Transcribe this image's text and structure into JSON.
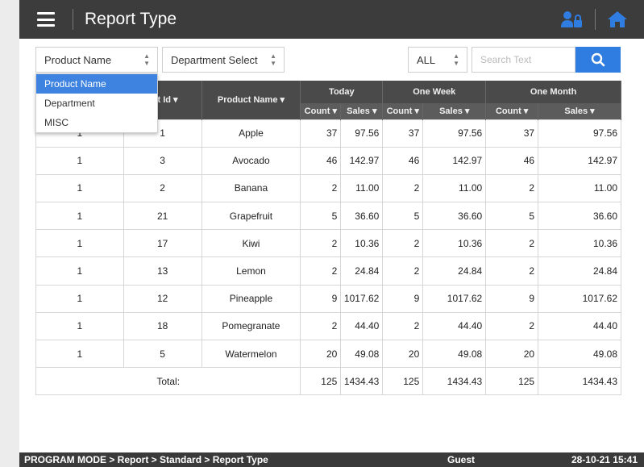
{
  "header": {
    "title": "Report Type",
    "menu_icon": "hamburger-icon",
    "user_icon": "users-lock-icon",
    "home_icon": "home-icon",
    "accent": "#2f7de1"
  },
  "filters": {
    "group_select": "Product Name",
    "department_select": "Department Select",
    "scope_select": "ALL",
    "search_placeholder": "Search Text",
    "search_value": ""
  },
  "dropdown": {
    "options": [
      "Product Name",
      "Department",
      "MISC"
    ],
    "selected": "Product Name"
  },
  "table": {
    "col1_header": "",
    "product_id_header": "uct Id ▾",
    "product_name_header": "Product Name ▾",
    "period_headers": [
      "Today",
      "One Week",
      "One Month"
    ],
    "sub_headers": [
      "Count ▾",
      "Sales ▾",
      "Count ▾",
      "Sales ▾",
      "Count ▾",
      "Sales ▾"
    ],
    "rows": [
      [
        "1",
        "1",
        "Apple",
        "37",
        "97.56",
        "37",
        "97.56",
        "37",
        "97.56"
      ],
      [
        "1",
        "3",
        "Avocado",
        "46",
        "142.97",
        "46",
        "142.97",
        "46",
        "142.97"
      ],
      [
        "1",
        "2",
        "Banana",
        "2",
        "11.00",
        "2",
        "11.00",
        "2",
        "11.00"
      ],
      [
        "1",
        "21",
        "Grapefruit",
        "5",
        "36.60",
        "5",
        "36.60",
        "5",
        "36.60"
      ],
      [
        "1",
        "17",
        "Kiwi",
        "2",
        "10.36",
        "2",
        "10.36",
        "2",
        "10.36"
      ],
      [
        "1",
        "13",
        "Lemon",
        "2",
        "24.84",
        "2",
        "24.84",
        "2",
        "24.84"
      ],
      [
        "1",
        "12",
        "Pineapple",
        "9",
        "1017.62",
        "9",
        "1017.62",
        "9",
        "1017.62"
      ],
      [
        "1",
        "18",
        "Pomegranate",
        "2",
        "44.40",
        "2",
        "44.40",
        "2",
        "44.40"
      ],
      [
        "1",
        "5",
        "Watermelon",
        "20",
        "49.08",
        "20",
        "49.08",
        "20",
        "49.08"
      ]
    ],
    "total_label": "Total:",
    "totals": [
      "125",
      "1434.43",
      "125",
      "1434.43",
      "125",
      "1434.43"
    ]
  },
  "statusbar": {
    "breadcrumb": "PROGRAM MODE > Report > Standard > Report Type",
    "user": "Guest",
    "datetime": "28-10-21 15:41"
  }
}
